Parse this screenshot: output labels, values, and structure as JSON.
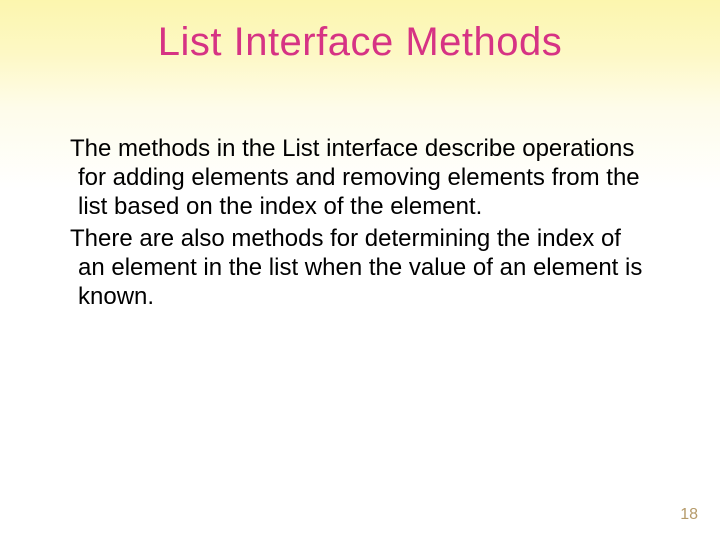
{
  "title": "List Interface Methods",
  "paragraphs": [
    "The methods in the List interface describe operations for adding elements and removing elements from the list based on the index of the element.",
    "There are also methods for determining the index of an element in the list when the value of an element is known."
  ],
  "page_number": "18"
}
